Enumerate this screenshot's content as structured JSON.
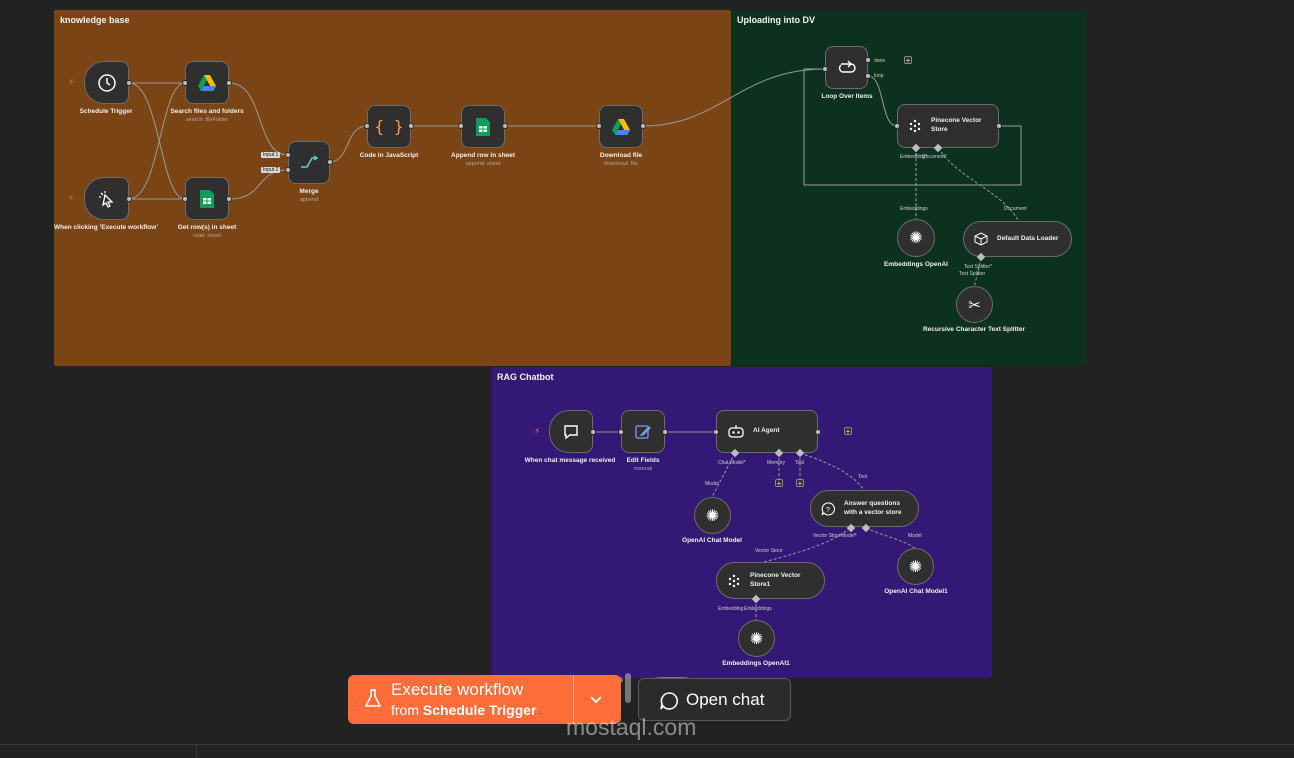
{
  "stickies": {
    "knowledge_base": "knowledge base",
    "uploading": "Uploading into DV",
    "rag": "RAG Chatbot"
  },
  "nodes": {
    "schedule": {
      "name": "Schedule Trigger"
    },
    "manual": {
      "name": "When clicking ‘Execute workflow’"
    },
    "search": {
      "name": "Search files and folders",
      "sub": "search: fileFolder"
    },
    "getrows": {
      "name": "Get row(s) in sheet",
      "sub": "read: sheet"
    },
    "merge": {
      "name": "Merge",
      "sub": "append",
      "input1": "Input 1",
      "input2": "Input 2"
    },
    "code": {
      "name": "Code in JavaScript"
    },
    "append": {
      "name": "Append row in sheet",
      "sub": "append: sheet"
    },
    "download": {
      "name": "Download file",
      "sub": "download: file"
    },
    "loop": {
      "name": "Loop Over Items",
      "done": "done",
      "loop": "loop"
    },
    "pinecone": {
      "name": "Pinecone Vector Store",
      "embedding": "Embedding*",
      "document": "Document*"
    },
    "embeddings": {
      "name": "Embeddings OpenAI",
      "port": "Embeddings"
    },
    "loader": {
      "name": "Default Data Loader",
      "port": "Document",
      "splitter": "Text Splitter*"
    },
    "splitter": {
      "name": "Recursive Character Text Splitter",
      "port": "Text Splitter"
    },
    "chat_trigger": {
      "name": "When chat message received"
    },
    "edit": {
      "name": "Edit Fields",
      "sub": "manual"
    },
    "agent": {
      "name": "AI Agent",
      "chat_model": "Chat Model*",
      "memory": "Memory",
      "tool": "Tool"
    },
    "openai_chat": {
      "name": "OpenAI Chat Model",
      "port": "Model"
    },
    "answer": {
      "name": "Answer questions with a vector store",
      "port": "Tool",
      "vstore": "Vector Store",
      "model": "Model*"
    },
    "openai_chat1": {
      "name": "OpenAI Chat Model1",
      "port": "Model"
    },
    "pinecone1": {
      "name": "Pinecone Vector Store1",
      "port": "Vector Store",
      "embedding": "Embedding",
      "embeddings": "Embeddings"
    },
    "embeddings1": {
      "name": "Embeddings OpenAI1"
    }
  },
  "toolbar": {
    "execute_label": "Execute workflow",
    "execute_from": "from",
    "execute_trigger": "Schedule Trigger",
    "open_chat": "Open chat"
  },
  "watermark": {
    "text": "mostaql.com"
  },
  "colors": {
    "accent": "#ff6d3a",
    "kb": "#7a4415",
    "upload": "#0d3120",
    "rag": "#331875"
  }
}
